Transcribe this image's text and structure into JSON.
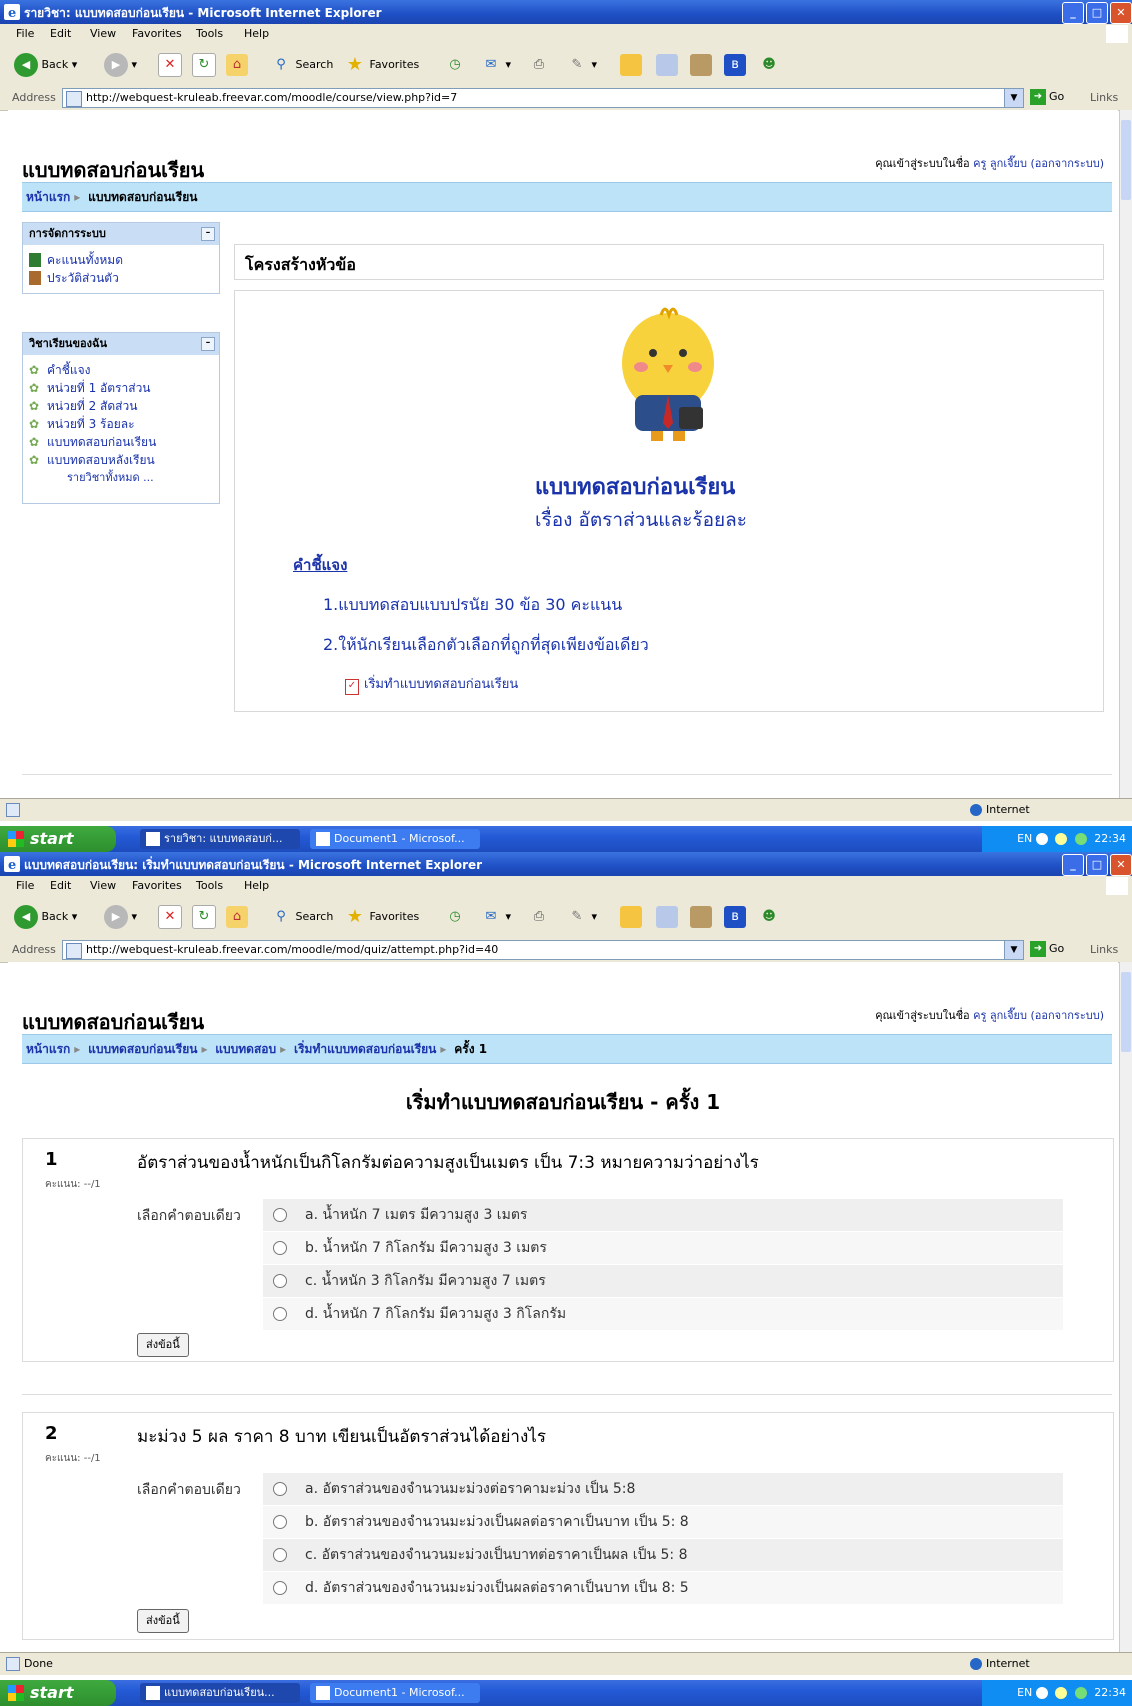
{
  "browser": {
    "menus": [
      "File",
      "Edit",
      "View",
      "Favorites",
      "Tools",
      "Help"
    ],
    "back_label": "Back",
    "search_label": "Search",
    "favorites_label": "Favorites",
    "address_label": "Address",
    "go_label": "Go",
    "links_label": "Links",
    "zone_label": "Internet"
  },
  "window1": {
    "title": "รายวิชา: แบบทดสอบก่อนเรียน - Microsoft Internet Explorer",
    "url": "http://webquest-kruleab.freevar.com/moodle/course/view.php?id=7",
    "page_title": "แบบทดสอบก่อนเรียน",
    "login_prefix": "คุณเข้าสู่ระบบในชื่อ",
    "login_user": "ครู ลูกเจี๊ยบ",
    "logout_label": "(ออกจากระบบ)",
    "breadcrumb": {
      "home": "หน้าแรก",
      "current": "แบบทดสอบก่อนเรียน"
    },
    "block_admin": {
      "title": "การจัดการระบบ",
      "items": [
        "คะแนนทั้งหมด",
        "ประวัติส่วนตัว"
      ]
    },
    "block_activities": {
      "title": "วิชาเรียนของฉัน",
      "items": [
        "คำชี้แจง",
        "หน่วยที่ 1 อัตราส่วน",
        "หน่วยที่ 2 สัดส่วน",
        "หน่วยที่ 3 ร้อยละ",
        "แบบทดสอบก่อนเรียน",
        "แบบทดสอบหลังเรียน"
      ],
      "all_courses": "รายวิชาทั้งหมด ..."
    },
    "section_title": "โครงสร้างหัวข้อ",
    "heading": "แบบทดสอบก่อนเรียน",
    "subheading": "เรื่อง อัตราส่วนและร้อยละ",
    "instructions_title": "คำชี้แจง",
    "instructions": [
      "1.แบบทดสอบแบบปรนัย 30 ข้อ 30 คะแนน",
      "2.ให้นักเรียนเลือกตัวเลือกที่ถูกที่สุดเพียงข้อเดียว"
    ],
    "quiz_link": "เริ่มทำแบบทดสอบก่อนเรียน",
    "status_left": "",
    "taskbar": {
      "start": "start",
      "tasks": [
        "รายวิชา: แบบทดสอบก่...",
        "Document1 - Microsof..."
      ],
      "clock": "22:34",
      "lang": "EN"
    }
  },
  "window2": {
    "title": "แบบทดสอบก่อนเรียน: เริ่มทำแบบทดสอบก่อนเรียน - Microsoft Internet Explorer",
    "url": "http://webquest-kruleab.freevar.com/moodle/mod/quiz/attempt.php?id=40",
    "page_title": "แบบทดสอบก่อนเรียน",
    "login_prefix": "คุณเข้าสู่ระบบในชื่อ",
    "login_user": "ครู ลูกเจี๊ยบ",
    "logout_label": "(ออกจากระบบ)",
    "breadcrumb": [
      "หน้าแรก",
      "แบบทดสอบก่อนเรียน",
      "แบบทดสอบ",
      "เริ่มทำแบบทดสอบก่อนเรียน",
      "ครั้ง 1"
    ],
    "quiz_title": "เริ่มทำแบบทดสอบก่อนเรียน - ครั้ง 1",
    "questions": [
      {
        "number": "1",
        "marks": "คะแนน: --/1",
        "text": "อัตราส่วนของน้ำหนักเป็นกิโลกรัมต่อความสูงเป็นเมตร เป็น 7:3 หมายความว่าอย่างไร",
        "prompt": "เลือกคำตอบเดียว",
        "options": [
          "a. น้ำหนัก 7 เมตร มีความสูง 3 เมตร",
          "b. น้ำหนัก 7 กิโลกรัม มีความสูง 3 เมตร",
          "c. น้ำหนัก 3 กิโลกรัม มีความสูง 7 เมตร",
          "d. น้ำหนัก 7 กิโลกรัม มีความสูง 3 กิโลกรัม"
        ],
        "submit": "ส่งข้อนี้"
      },
      {
        "number": "2",
        "marks": "คะแนน: --/1",
        "text": "มะม่วง 5 ผล ราคา 8 บาท  เขียนเป็นอัตราส่วนได้อย่างไร",
        "prompt": "เลือกคำตอบเดียว",
        "options": [
          "a. อัตราส่วนของจำนวนมะม่วงต่อราคามะม่วง เป็น 5:8",
          "b. อัตราส่วนของจำนวนมะม่วงเป็นผลต่อราคาเป็นบาท เป็น 5: 8",
          "c. อัตราส่วนของจำนวนมะม่วงเป็นบาทต่อราคาเป็นผล เป็น 5: 8",
          "d. อัตราส่วนของจำนวนมะม่วงเป็นผลต่อราคาเป็นบาท เป็น 8: 5"
        ],
        "submit": "ส่งข้อนี้"
      }
    ],
    "status_left": "Done",
    "taskbar": {
      "start": "start",
      "tasks": [
        "แบบทดสอบก่อนเรียน...",
        "Document1 - Microsof..."
      ],
      "clock": "22:34",
      "lang": "EN"
    }
  }
}
